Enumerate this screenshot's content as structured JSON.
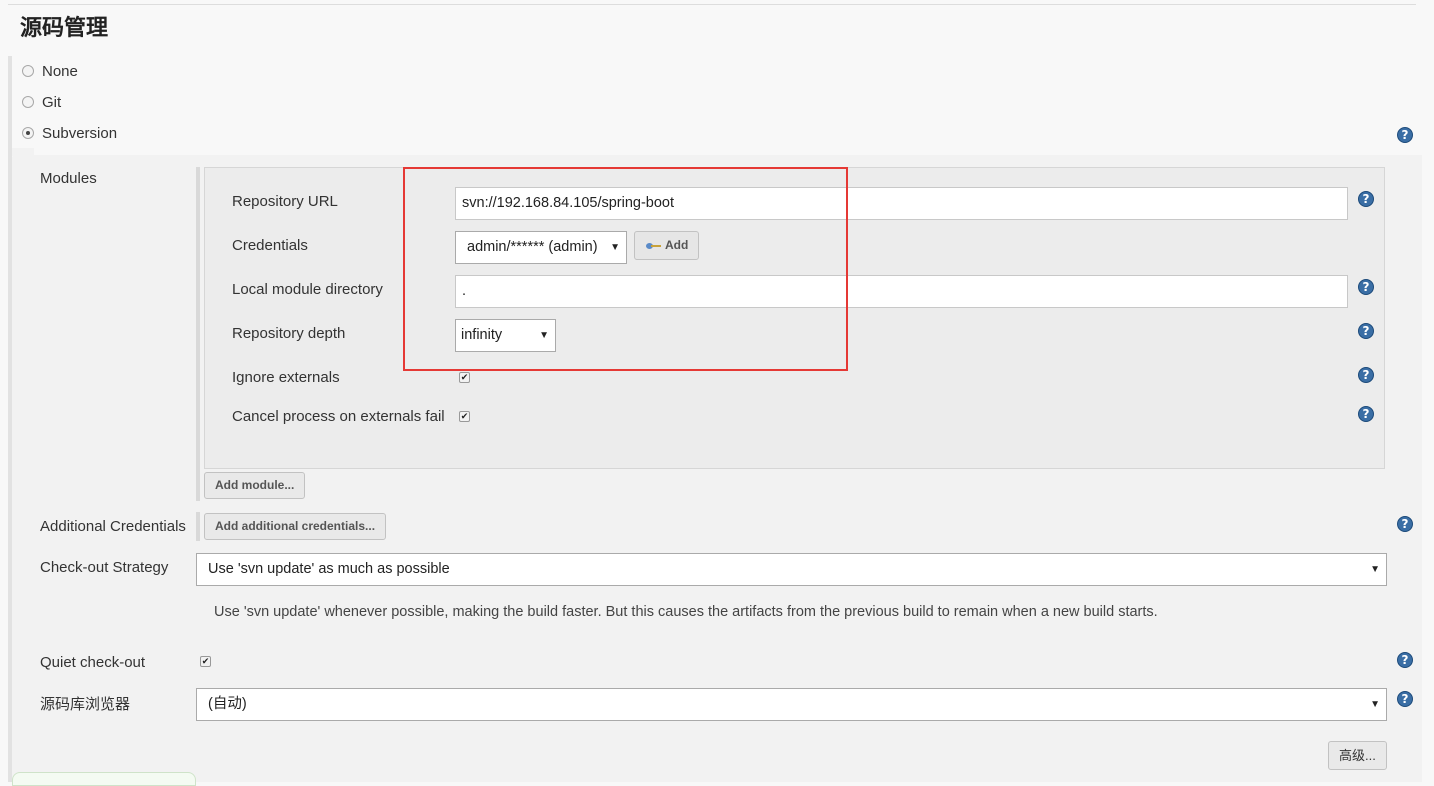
{
  "section": {
    "title": "源码管理"
  },
  "scm_options": [
    {
      "label": "None",
      "checked": false
    },
    {
      "label": "Git",
      "checked": false
    },
    {
      "label": "Subversion",
      "checked": true
    }
  ],
  "modules": {
    "label": "Modules",
    "repository_url": {
      "label": "Repository URL",
      "value": "svn://192.168.84.105/spring-boot"
    },
    "credentials": {
      "label": "Credentials",
      "value": "admin/****** (admin)",
      "add_label": "Add"
    },
    "local_module_directory": {
      "label": "Local module directory",
      "value": "."
    },
    "repository_depth": {
      "label": "Repository depth",
      "value": "infinity"
    },
    "ignore_externals": {
      "label": "Ignore externals",
      "checked": true
    },
    "cancel_on_externals_fail": {
      "label": "Cancel process on externals fail",
      "checked": true
    },
    "add_module_label": "Add module..."
  },
  "additional_credentials": {
    "label": "Additional Credentials",
    "button_label": "Add additional credentials..."
  },
  "checkout_strategy": {
    "label": "Check-out Strategy",
    "value": "Use 'svn update' as much as possible",
    "description": "Use 'svn update' whenever possible, making the build faster. But this causes the artifacts from the previous build to remain when a new build starts."
  },
  "quiet_checkout": {
    "label": "Quiet check-out",
    "checked": true
  },
  "repo_browser": {
    "label": "源码库浏览器",
    "value": "(自动)"
  },
  "advanced": {
    "label": "高级..."
  },
  "glyphs": {
    "help": "?",
    "check": "✔",
    "dropdown": "▼"
  },
  "colors": {
    "highlight": "#e53935",
    "help_icon": "#3a6ea5"
  }
}
